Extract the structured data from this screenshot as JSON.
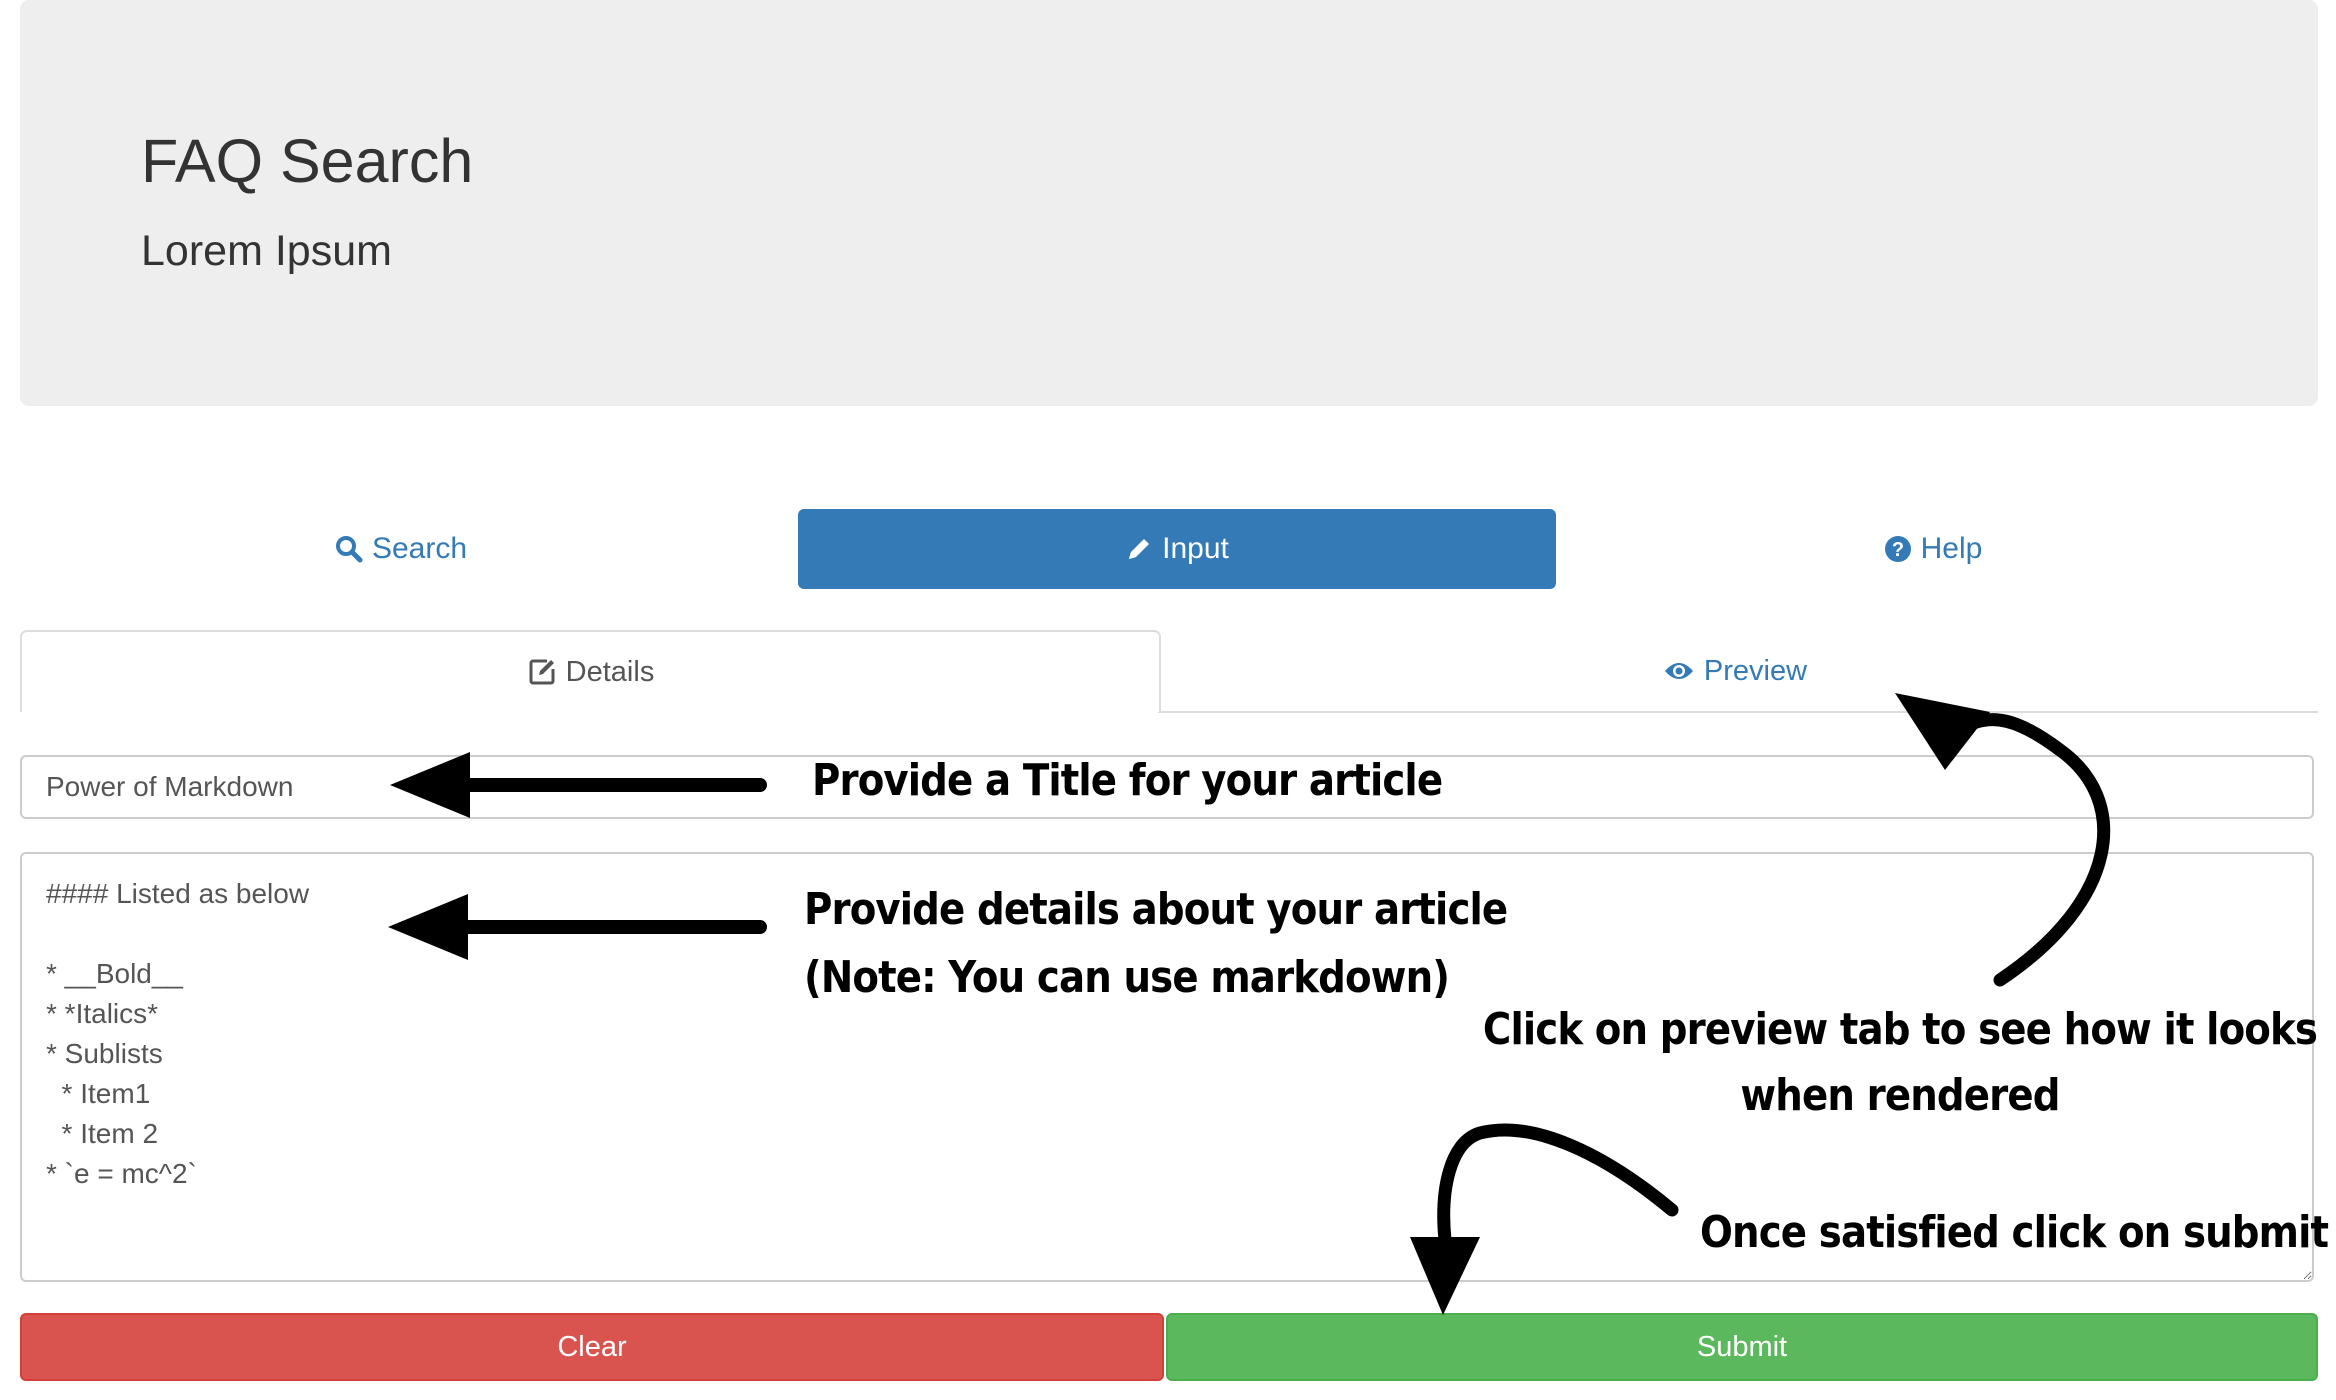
{
  "header": {
    "title": "FAQ Search",
    "subtitle": "Lorem Ipsum"
  },
  "nav": {
    "search_label": "Search",
    "input_label": "Input",
    "help_label": "Help",
    "active": "Input"
  },
  "tabs": {
    "details_label": "Details",
    "preview_label": "Preview",
    "active": "Details"
  },
  "form": {
    "title_value": "Power of Markdown",
    "details_value": "#### Listed as below\n\n* __Bold__\n* *Italics*\n* Sublists\n  * Item1\n  * Item 2\n* `e = mc^2`"
  },
  "buttons": {
    "clear_label": "Clear",
    "submit_label": "Submit"
  },
  "annotations": {
    "title_note": "Provide a Title for your article",
    "details_note_line1": "Provide details about your article",
    "details_note_line2": "(Note: You can use markdown)",
    "preview_note_line1": "Click on preview tab to see how it looks",
    "preview_note_line2": "when rendered",
    "submit_note": "Once satisfied click on submit"
  },
  "colors": {
    "primary": "#337ab7",
    "danger": "#d9534f",
    "success": "#5cb85c",
    "jumbotron": "#eeeeee"
  },
  "icons": {
    "search": "search-icon",
    "input": "pencil-icon",
    "help": "question-circle-icon",
    "details": "edit-icon",
    "preview": "eye-icon"
  }
}
